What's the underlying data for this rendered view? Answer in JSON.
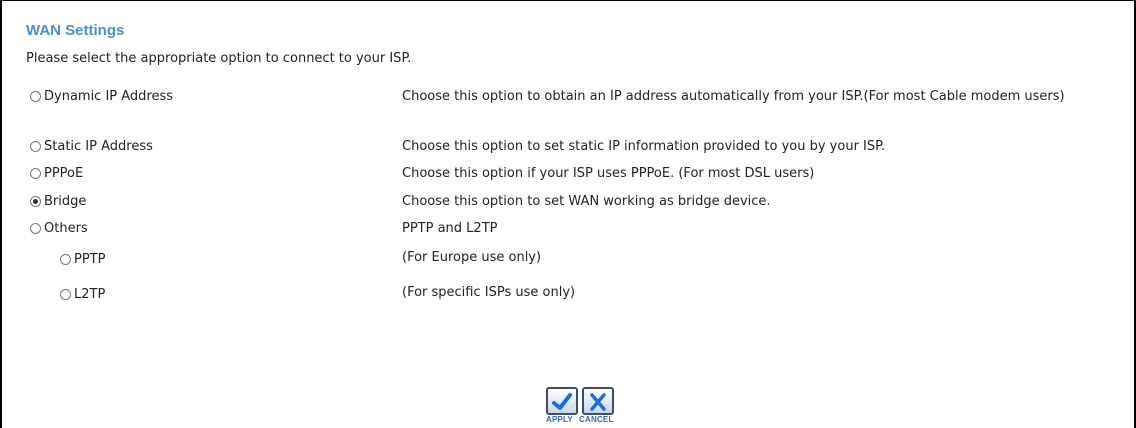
{
  "page": {
    "title": "WAN Settings",
    "intro": "Please select the appropriate option to connect to your ISP."
  },
  "options": [
    {
      "label": "Dynamic IP Address",
      "description": "Choose this option to obtain an IP address automatically from your ISP.(For most Cable modem users)",
      "selected": false
    },
    {
      "label": "Static IP Address",
      "description": "Choose this option to set static IP information provided to you by your ISP.",
      "selected": false
    },
    {
      "label": "PPPoE",
      "description": "Choose this option if your ISP uses PPPoE. (For most DSL users)",
      "selected": false
    },
    {
      "label": "Bridge",
      "description": "Choose this option to set WAN working as bridge device.",
      "selected": true
    },
    {
      "label": "Others",
      "description": "PPTP and L2TP",
      "selected": false
    }
  ],
  "sub_options": [
    {
      "label": "PPTP",
      "description": "(For Europe use only)",
      "selected": false
    },
    {
      "label": "L2TP",
      "description": "(For specific ISPs use only)",
      "selected": false
    }
  ],
  "buttons": {
    "apply_label": "APPLY",
    "cancel_label": "CANCEL",
    "apply_icon": "check-icon",
    "cancel_icon": "x-icon"
  },
  "colors": {
    "title": "#4b8fd0",
    "button_label": "#3c62b5",
    "apply_mark": "#1d6fd6",
    "cancel_mark": "#1d6fd6"
  }
}
